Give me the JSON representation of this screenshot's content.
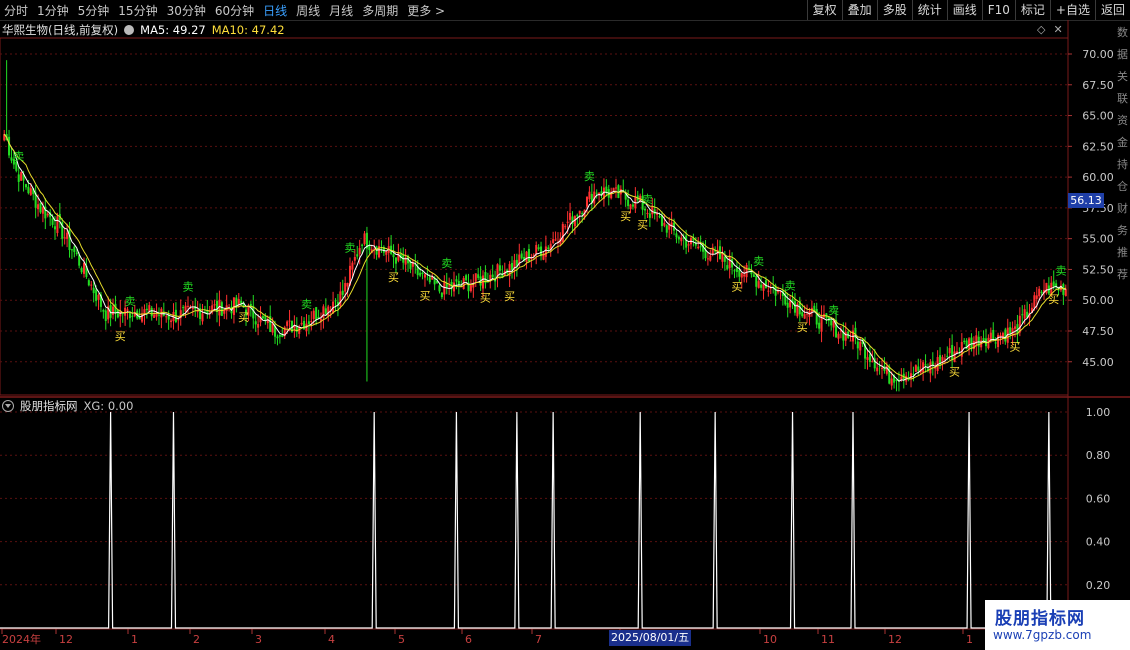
{
  "toolbar": {
    "tabs": [
      {
        "label": "分时",
        "active": false
      },
      {
        "label": "1分钟",
        "active": false
      },
      {
        "label": "5分钟",
        "active": false
      },
      {
        "label": "15分钟",
        "active": false
      },
      {
        "label": "30分钟",
        "active": false
      },
      {
        "label": "60分钟",
        "active": false
      },
      {
        "label": "日线",
        "active": true
      },
      {
        "label": "周线",
        "active": false
      },
      {
        "label": "月线",
        "active": false
      },
      {
        "label": "多周期",
        "active": false
      },
      {
        "label": "更多 >",
        "active": false
      }
    ],
    "tools": [
      "复权",
      "叠加",
      "多股",
      "统计",
      "画线",
      "F10",
      "标记",
      "+自选",
      "返回"
    ]
  },
  "main_panel": {
    "stock_name": "华熙生物(日线,前复权)",
    "ma5_text": "MA5: 49.27",
    "ma10_text": "MA10: 47.42",
    "current_price": "56.13",
    "y_ticks": [
      "70.00",
      "67.50",
      "65.00",
      "62.50",
      "60.00",
      "57.50",
      "55.00",
      "52.50",
      "50.00",
      "47.50",
      "45.00"
    ]
  },
  "sub_panel": {
    "title": "股朋指标网",
    "xg_text": "XG: 0.00",
    "y_ticks": [
      "1.00",
      "0.80",
      "0.60",
      "0.40",
      "0.20"
    ]
  },
  "x_axis": {
    "labels": [
      "2024年",
      "12",
      "1",
      "2",
      "3",
      "4",
      "5",
      "6",
      "7",
      "8",
      "10",
      "11",
      "12",
      "1"
    ],
    "highlight_date": "2025/08/01/五"
  },
  "right_strip": [
    "数",
    "据",
    "关",
    "联",
    "资",
    "金",
    "持",
    "仓",
    "财",
    "务",
    "推",
    "荐"
  ],
  "watermark": {
    "title": "股朋指标网",
    "url": "www.7gpzb.com"
  },
  "signals": {
    "buy": "买",
    "sell": "卖"
  },
  "colors": {
    "up": "#ff3030",
    "down": "#22dd22",
    "ma5": "#ffffff",
    "ma10": "#e6dd2a",
    "grid": "#5a1010",
    "axis": "#7a1a1a"
  },
  "chart_data": {
    "type": "candlestick",
    "key_closes_by_index": [
      [
        0,
        63.5
      ],
      [
        5,
        60.5
      ],
      [
        15,
        57.5
      ],
      [
        22,
        56.2
      ],
      [
        30,
        53.5
      ],
      [
        42,
        48.9
      ],
      [
        55,
        49.1
      ],
      [
        70,
        48.7
      ],
      [
        85,
        49.3
      ],
      [
        98,
        49.6
      ],
      [
        112,
        47.5
      ],
      [
        125,
        48.3
      ],
      [
        140,
        50.5
      ],
      [
        148,
        55
      ],
      [
        162,
        53.5
      ],
      [
        180,
        50.8
      ],
      [
        195,
        51.5
      ],
      [
        210,
        52.8
      ],
      [
        225,
        54.5
      ],
      [
        245,
        59
      ],
      [
        262,
        58
      ],
      [
        280,
        55
      ],
      [
        300,
        53
      ],
      [
        318,
        50.9
      ],
      [
        335,
        48.6
      ],
      [
        352,
        46.8
      ],
      [
        366,
        43.8
      ],
      [
        382,
        44.5
      ],
      [
        400,
        46.7
      ],
      [
        418,
        47.5
      ],
      [
        430,
        51
      ]
    ],
    "sell_signals_index": [
      6,
      52,
      76,
      125,
      143,
      183,
      242,
      266,
      312,
      325,
      343,
      437
    ],
    "buy_signals_index": [
      48,
      99,
      161,
      174,
      199,
      209,
      257,
      264,
      303,
      330,
      393,
      418,
      434
    ],
    "xg_spikes_index": [
      44,
      70,
      153,
      187,
      212,
      227,
      263,
      294,
      326,
      351,
      399,
      432
    ]
  }
}
